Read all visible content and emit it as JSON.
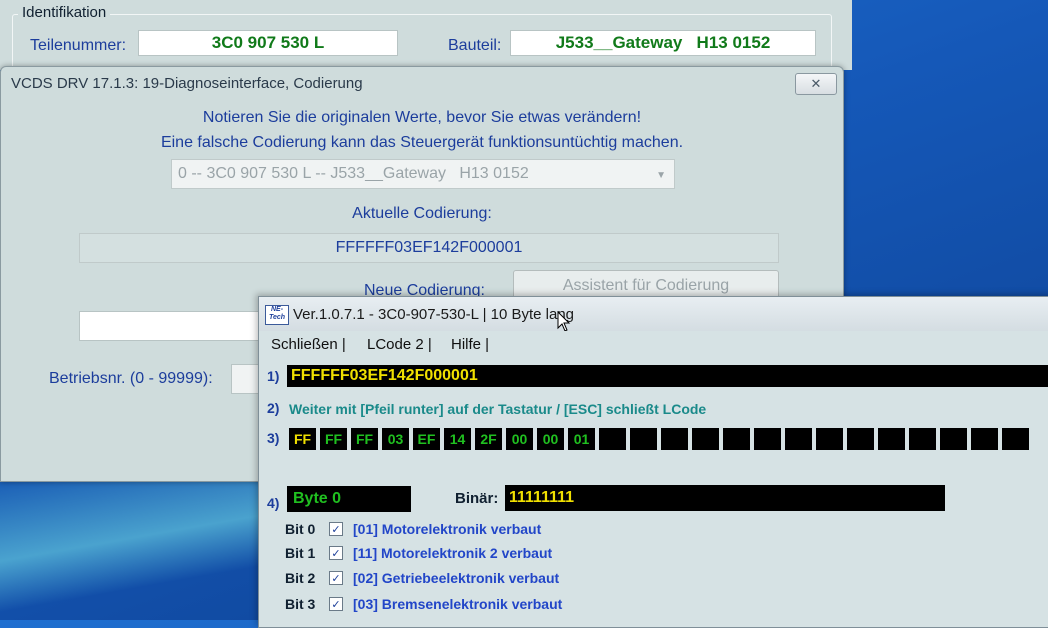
{
  "identifikation": {
    "legend": "Identifikation",
    "teilenummer_label": "Teilenummer:",
    "teilenummer_value": "3C0 907 530 L",
    "bauteil_label": "Bauteil:",
    "bauteil_value": "J533__Gateway   H13 0152"
  },
  "dialog": {
    "title": "VCDS DRV 17.1.3: 19-Diagnoseinterface,  Codierung",
    "close_icon": "close-icon",
    "notice_line1": "Notieren Sie die originalen Werte, bevor Sie etwas verändern!",
    "notice_line2": "Eine falsche Codierung kann das Steuergerät funktionsuntüchtig machen.",
    "module_select_value": "0 -- 3C0 907 530 L -- J533__Gateway   H13 0152",
    "current_coding_label": "Aktuelle Codierung:",
    "current_coding_value": "FFFFFF03EF142F000001",
    "new_coding_label": "Neue Codierung:",
    "assistant_button": "Assistent für Codierung",
    "betriebsnr_label": "Betriebsnr. (0 - 99999):"
  },
  "lcode": {
    "logo_text": "NE- Tech",
    "title": "Ver.1.0.7.1 -   3C0-907-530-L | 10 Byte lang",
    "menu": [
      "Schließen |",
      "LCode 2 |",
      "Hilfe |"
    ],
    "row1_label": "1)",
    "row1_value": "FFFFFF03EF142F000001",
    "row2_label": "2)",
    "row2_text": "Weiter mit [Pfeil runter] auf der Tastatur / [ESC] schließt LCode",
    "row3_label": "3)",
    "bytes": [
      "FF",
      "FF",
      "FF",
      "03",
      "EF",
      "14",
      "2F",
      "00",
      "00",
      "01",
      "",
      "",
      "",
      "",
      "",
      "",
      "",
      "",
      "",
      "",
      "",
      "",
      "",
      ""
    ],
    "row4_label": "4)",
    "byte_label": "Byte 0",
    "binar_label": "Binär:",
    "binar_value": "11111111",
    "bits": [
      {
        "label": "Bit 0",
        "checked": true,
        "text": "[01] Motorelektronik verbaut"
      },
      {
        "label": "Bit 1",
        "checked": true,
        "text": "[11] Motorelektronik 2 verbaut"
      },
      {
        "label": "Bit 2",
        "checked": true,
        "text": "[02] Getriebeelektronik verbaut"
      },
      {
        "label": "Bit 3",
        "checked": true,
        "text": "[03] Bremsenelektronik verbaut"
      }
    ]
  }
}
